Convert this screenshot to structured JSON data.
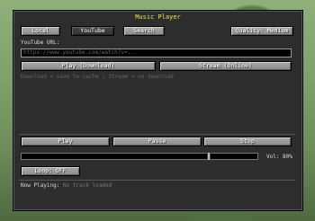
{
  "window": {
    "title": "Music Player"
  },
  "tabs": {
    "local": "Local",
    "youtube": "YouTube",
    "search": "Search"
  },
  "quality": {
    "label": "Quality: Medium"
  },
  "youtube": {
    "url_label": "YouTube URL:",
    "url_placeholder": "https://www.youtube.com/watch?v=...",
    "play_download_label": "Play (Download)",
    "stream_label": "Stream (Online)",
    "hint": "Download = save to cache  |  Stream = no download"
  },
  "controls": {
    "play": "Play",
    "pause": "Pause",
    "stop": "Stop"
  },
  "volume": {
    "label": "Vol: 80%",
    "value": 0.8
  },
  "loop": {
    "label": "Loop: OFF"
  },
  "now_playing": {
    "label": "Now Playing:",
    "value": "No track loaded"
  }
}
